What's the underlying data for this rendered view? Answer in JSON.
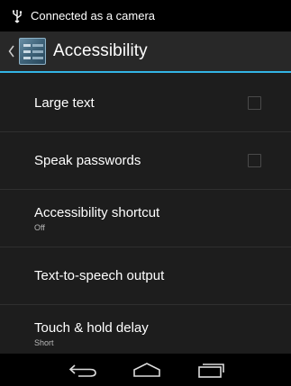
{
  "status_bar": {
    "notification_text": "Connected as a camera",
    "usb_icon": "usb-icon"
  },
  "action_bar": {
    "title": "Accessibility",
    "up_icon": "up-caret-icon",
    "app_icon": "accessibility-settings-icon",
    "accent_color": "#33b5e5"
  },
  "settings": {
    "items": [
      {
        "title": "Large text",
        "summary": "",
        "has_checkbox": true,
        "checked": false
      },
      {
        "title": "Speak passwords",
        "summary": "",
        "has_checkbox": true,
        "checked": false
      },
      {
        "title": "Accessibility shortcut",
        "summary": "Off",
        "has_checkbox": false
      },
      {
        "title": "Text-to-speech output",
        "summary": "",
        "has_checkbox": false
      },
      {
        "title": "Touch & hold delay",
        "summary": "Short",
        "has_checkbox": false
      }
    ]
  },
  "nav_bar": {
    "back_icon": "back-icon",
    "home_icon": "home-icon",
    "recents_icon": "recent-apps-icon"
  }
}
